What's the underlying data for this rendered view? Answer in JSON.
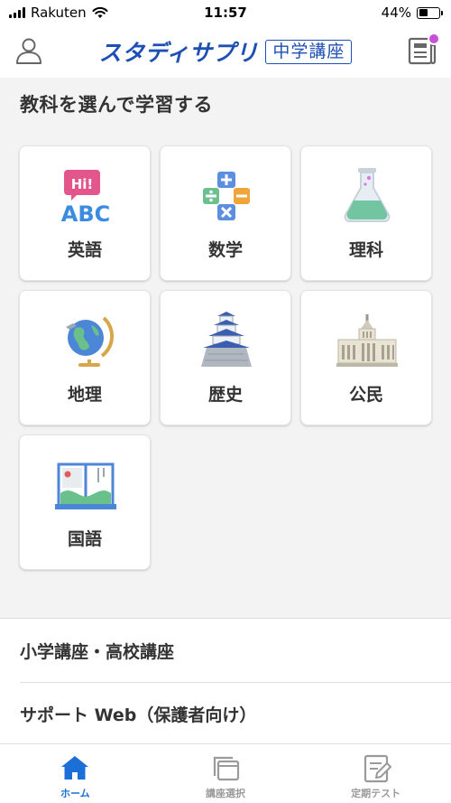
{
  "status_bar": {
    "carrier": "Rakuten",
    "time": "11:57",
    "battery": "44%",
    "battery_level": 0.44
  },
  "header": {
    "logo_main": "スタディサプリ",
    "logo_sub": "中学講座"
  },
  "section_title": "教科を選んで学習する",
  "subjects": [
    {
      "label": "英語",
      "icon": "english-abc-icon"
    },
    {
      "label": "数学",
      "icon": "math-operators-icon"
    },
    {
      "label": "理科",
      "icon": "flask-icon"
    },
    {
      "label": "地理",
      "icon": "globe-icon"
    },
    {
      "label": "歴史",
      "icon": "castle-icon"
    },
    {
      "label": "公民",
      "icon": "diet-building-icon"
    },
    {
      "label": "国語",
      "icon": "open-book-icon"
    }
  ],
  "icon_texts": {
    "english_bubble": "Hi!",
    "english_abc": "ABC"
  },
  "links": [
    {
      "label": "小学講座・高校講座"
    },
    {
      "label": "サポート Web（保護者向け）"
    }
  ],
  "tabs": [
    {
      "label": "ホーム",
      "icon": "home-icon",
      "active": true
    },
    {
      "label": "講座選択",
      "icon": "course-select-icon",
      "active": false
    },
    {
      "label": "定期テスト",
      "icon": "test-clipboard-icon",
      "active": false
    }
  ],
  "colors": {
    "brand": "#1d4fb4",
    "active_tab": "#1d6fd8",
    "notification": "#c94fd8"
  }
}
